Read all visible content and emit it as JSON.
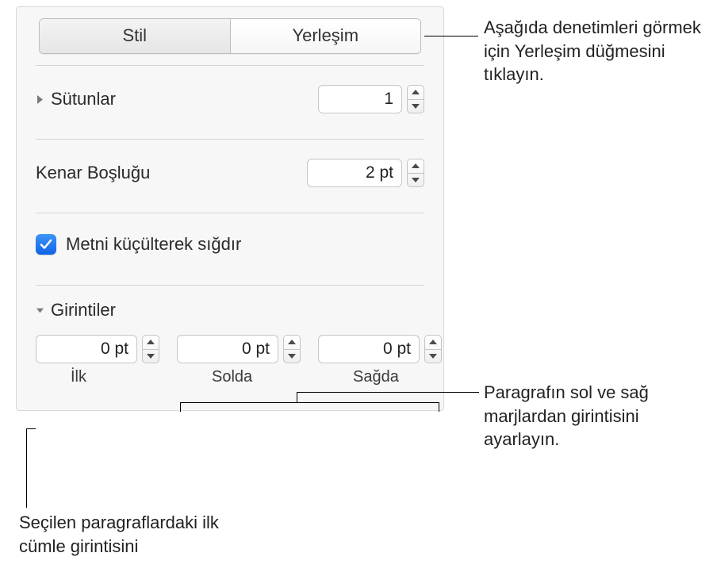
{
  "tabs": {
    "stil": "Stil",
    "yerlesim": "Yerleşim"
  },
  "columns": {
    "label": "Sütunlar",
    "value": "1"
  },
  "margin": {
    "label": "Kenar Boşluğu",
    "value": "2 pt"
  },
  "shrink": {
    "label": "Metni küçülterek sığdır",
    "checked": true
  },
  "indents": {
    "label": "Girintiler",
    "first": {
      "value": "0 pt",
      "label": "İlk"
    },
    "left": {
      "value": "0 pt",
      "label": "Solda"
    },
    "right": {
      "value": "0 pt",
      "label": "Sağda"
    }
  },
  "callouts": {
    "top": "Aşağıda denetimleri görmek için Yerleşim düğmesini tıklayın.",
    "middle": "Paragrafın sol ve sağ marjlardan girintisini ayarlayın.",
    "bottom": "Seçilen paragraflardaki ilk cümle girintisini"
  }
}
